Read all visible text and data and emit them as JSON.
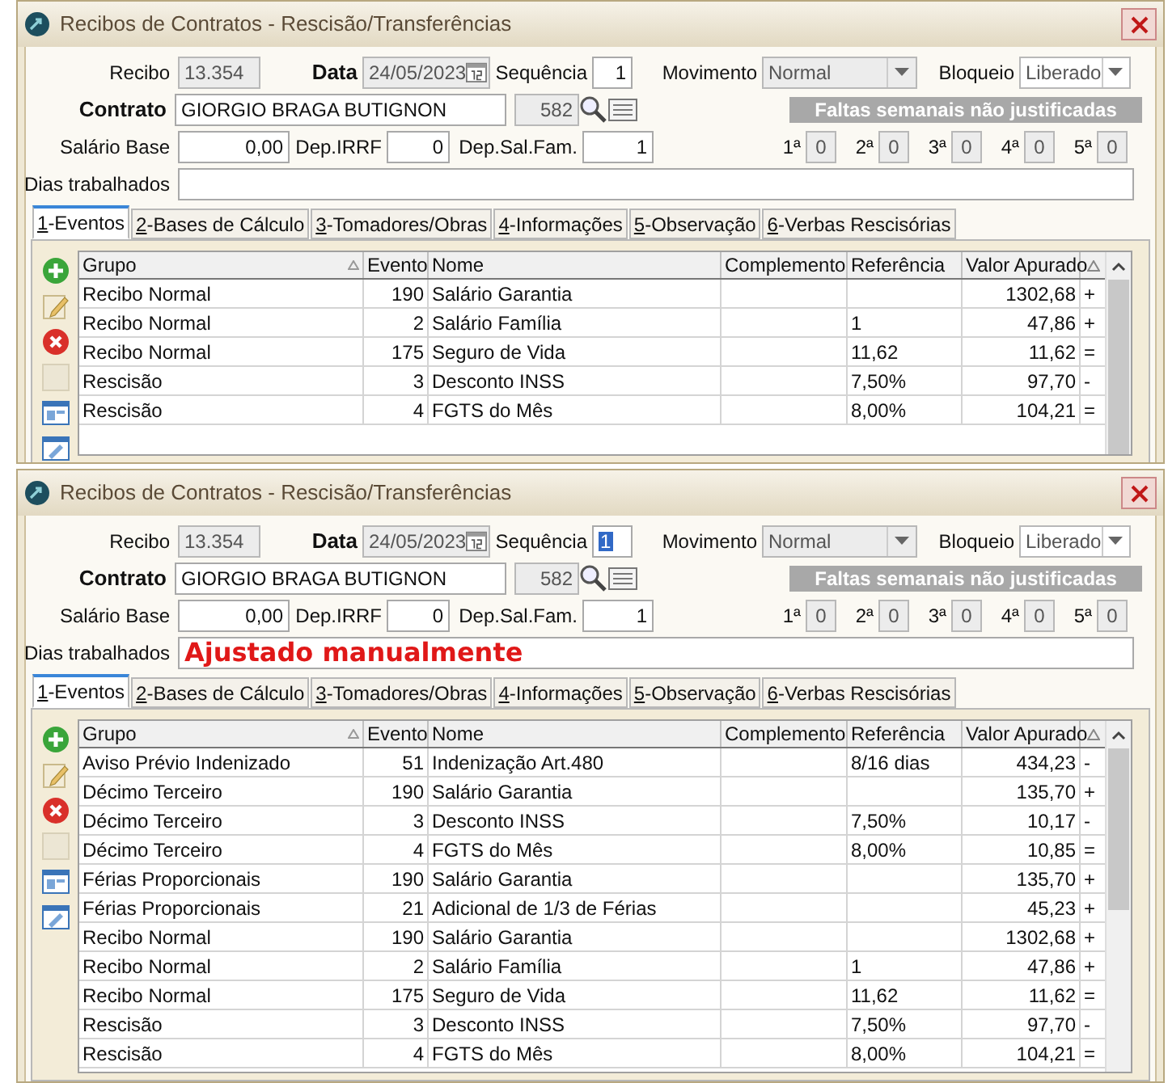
{
  "windows": [
    {
      "title": "Recibos de Contratos - Rescisão/Transferências",
      "recibo_label": "Recibo",
      "recibo": "13.354",
      "data_label": "Data",
      "data": "24/05/2023",
      "sequencia_label": "Sequência",
      "sequencia": {
        "value": "1",
        "focused": false
      },
      "movimento_label": "Movimento",
      "movimento": "Normal",
      "bloqueio_label": "Bloqueio",
      "bloqueio": "Liberado",
      "contrato_label": "Contrato",
      "contrato": "GIORGIO BRAGA BUTIGNON",
      "contrato_codigo": "582",
      "faltas_title": "Faltas semanais não justificadas",
      "salario_base_label": "Salário Base",
      "salario_base": "0,00",
      "dep_irrf_label": "Dep.IRRF",
      "dep_irrf": "0",
      "dep_sal_fam_label": "Dep.Sal.Fam.",
      "dep_sal_fam": "1",
      "semanas": [
        {
          "label": "1ª",
          "value": "0"
        },
        {
          "label": "2ª",
          "value": "0"
        },
        {
          "label": "3ª",
          "value": "0"
        },
        {
          "label": "4ª",
          "value": "0"
        },
        {
          "label": "5ª",
          "value": "0"
        }
      ],
      "dias_trabalhados_label": "Dias trabalhados",
      "tabs": [
        {
          "label": "1-Eventos",
          "selected": true
        },
        {
          "label": "2-Bases de Cálculo",
          "selected": false
        },
        {
          "label": "3-Tomadores/Obras",
          "selected": false
        },
        {
          "label": "4-Informações",
          "selected": false
        },
        {
          "label": "5-Observação",
          "selected": false
        },
        {
          "label": "6-Verbas Rescisórias",
          "selected": false
        }
      ],
      "table": {
        "columns": [
          "Grupo",
          "Evento",
          "Nome",
          "Complemento",
          "Referência",
          "Valor Apurado"
        ],
        "rows": [
          {
            "grupo": "Recibo Normal",
            "evento": "190",
            "nome": "Salário Garantia",
            "valor": "1302,68",
            "sinal": "+"
          },
          {
            "grupo": "Recibo Normal",
            "evento": "2",
            "nome": "Salário Família",
            "referencia": "1",
            "valor": "47,86",
            "sinal": "+"
          },
          {
            "grupo": "Recibo Normal",
            "evento": "175",
            "nome": "Seguro de Vida",
            "referencia": "11,62",
            "valor": "11,62",
            "sinal": "="
          },
          {
            "grupo": "Rescisão",
            "evento": "3",
            "nome": "Desconto INSS",
            "referencia": "7,50%",
            "valor": "97,70",
            "sinal": "-"
          },
          {
            "grupo": "Rescisão",
            "evento": "4",
            "nome": "FGTS do Mês",
            "referencia": "8,00%",
            "valor": "104,21",
            "sinal": "="
          }
        ]
      }
    },
    {
      "title": "Recibos de Contratos - Rescisão/Transferências",
      "recibo_label": "Recibo",
      "recibo": "13.354",
      "data_label": "Data",
      "data": "24/05/2023",
      "sequencia_label": "Sequência",
      "sequencia": {
        "value": "1",
        "focused": true
      },
      "movimento_label": "Movimento",
      "movimento": "Normal",
      "bloqueio_label": "Bloqueio",
      "bloqueio": "Liberado",
      "contrato_label": "Contrato",
      "contrato": "GIORGIO BRAGA BUTIGNON",
      "contrato_codigo": "582",
      "faltas_title": "Faltas semanais não justificadas",
      "salario_base_label": "Salário Base",
      "salario_base": "0,00",
      "dep_irrf_label": "Dep.IRRF",
      "dep_irrf": "0",
      "dep_sal_fam_label": "Dep.Sal.Fam.",
      "dep_sal_fam": "1",
      "semanas": [
        {
          "label": "1ª",
          "value": "0"
        },
        {
          "label": "2ª",
          "value": "0"
        },
        {
          "label": "3ª",
          "value": "0"
        },
        {
          "label": "4ª",
          "value": "0"
        },
        {
          "label": "5ª",
          "value": "0"
        }
      ],
      "dias_trabalhados_label": "Dias trabalhados",
      "dias_trabalhados": "Ajustado manualmente",
      "tabs": [
        {
          "label": "1-Eventos",
          "selected": true
        },
        {
          "label": "2-Bases de Cálculo",
          "selected": false
        },
        {
          "label": "3-Tomadores/Obras",
          "selected": false
        },
        {
          "label": "4-Informações",
          "selected": false
        },
        {
          "label": "5-Observação",
          "selected": false
        },
        {
          "label": "6-Verbas Rescisórias",
          "selected": false
        }
      ],
      "table": {
        "columns": [
          "Grupo",
          "Evento",
          "Nome",
          "Complemento",
          "Referência",
          "Valor Apurado"
        ],
        "rows": [
          {
            "grupo": "Aviso Prévio Indenizado",
            "evento": "51",
            "nome": "Indenização Art.480",
            "referencia": "8/16 dias",
            "valor": "434,23",
            "sinal": "-"
          },
          {
            "grupo": "Décimo Terceiro",
            "evento": "190",
            "nome": "Salário Garantia",
            "valor": "135,70",
            "sinal": "+"
          },
          {
            "grupo": "Décimo Terceiro",
            "evento": "3",
            "nome": "Desconto INSS",
            "referencia": "7,50%",
            "valor": "10,17",
            "sinal": "-"
          },
          {
            "grupo": "Décimo Terceiro",
            "evento": "4",
            "nome": "FGTS do Mês",
            "referencia": "8,00%",
            "valor": "10,85",
            "sinal": "="
          },
          {
            "grupo": "Férias Proporcionais",
            "evento": "190",
            "nome": "Salário Garantia",
            "valor": "135,70",
            "sinal": "+"
          },
          {
            "grupo": "Férias Proporcionais",
            "evento": "21",
            "nome": "Adicional de 1/3 de Férias",
            "valor": "45,23",
            "sinal": "+"
          },
          {
            "grupo": "Recibo Normal",
            "evento": "190",
            "nome": "Salário Garantia",
            "valor": "1302,68",
            "sinal": "+"
          },
          {
            "grupo": "Recibo Normal",
            "evento": "2",
            "nome": "Salário Família",
            "referencia": "1",
            "valor": "47,86",
            "sinal": "+"
          },
          {
            "grupo": "Recibo Normal",
            "evento": "175",
            "nome": "Seguro de Vida",
            "referencia": "11,62",
            "valor": "11,62",
            "sinal": "="
          },
          {
            "grupo": "Rescisão",
            "evento": "3",
            "nome": "Desconto INSS",
            "referencia": "7,50%",
            "valor": "97,70",
            "sinal": "-"
          },
          {
            "grupo": "Rescisão",
            "evento": "4",
            "nome": "FGTS do Mês",
            "referencia": "8,00%",
            "valor": "104,21",
            "sinal": "="
          }
        ]
      }
    }
  ]
}
